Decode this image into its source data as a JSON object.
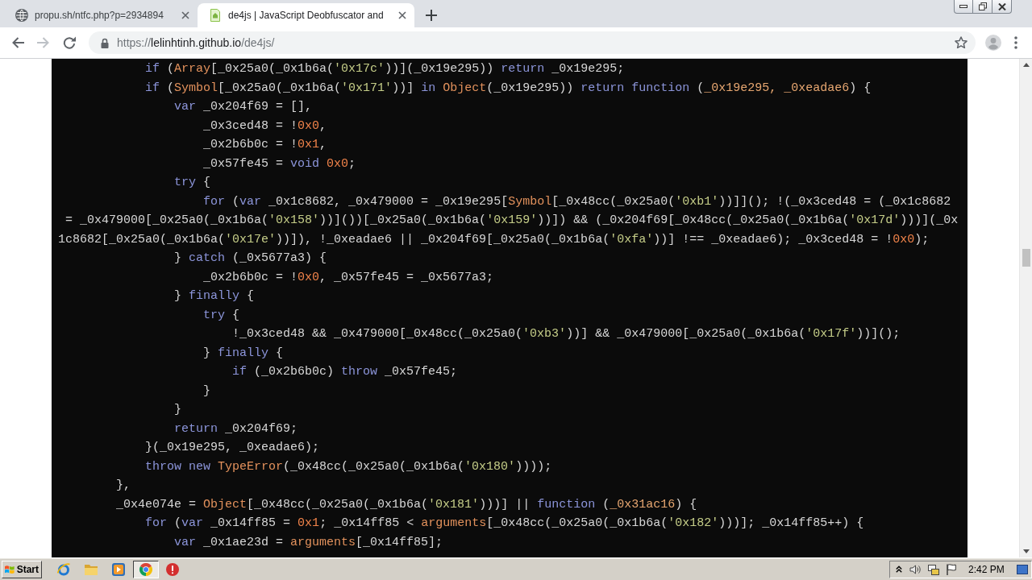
{
  "browser": {
    "tabs": [
      {
        "title": "propu.sh/ntfc.php?p=2934894",
        "selected": false
      },
      {
        "title": "de4js | JavaScript Deobfuscator and",
        "selected": true
      }
    ],
    "back": {
      "disabled": false
    },
    "forward": {
      "disabled": true
    },
    "address_bar": {
      "scheme": "https://",
      "host": "lelinhtinh.github.io",
      "path": "/de4js/"
    }
  },
  "code": {
    "lines": [
      [
        {
          "kind": "keyword",
          "text": "            if"
        },
        {
          "kind": "plain",
          "text": " ("
        },
        {
          "kind": "builtin",
          "text": "Array"
        },
        {
          "kind": "plain",
          "text": "[_0x25a0(_0x1b6a("
        },
        {
          "kind": "string",
          "text": "'0x17c'"
        },
        {
          "kind": "plain",
          "text": "))](_0x19e295)) "
        },
        {
          "kind": "keyword",
          "text": "return"
        },
        {
          "kind": "plain",
          "text": " _0x19e295;"
        }
      ],
      [
        {
          "kind": "keyword",
          "text": "            if"
        },
        {
          "kind": "plain",
          "text": " ("
        },
        {
          "kind": "builtin",
          "text": "Symbol"
        },
        {
          "kind": "plain",
          "text": "[_0x25a0(_0x1b6a("
        },
        {
          "kind": "string",
          "text": "'0x171'"
        },
        {
          "kind": "plain",
          "text": "))] "
        },
        {
          "kind": "keyword",
          "text": "in "
        },
        {
          "kind": "builtin",
          "text": "Object"
        },
        {
          "kind": "plain",
          "text": "(_0x19e295)) "
        },
        {
          "kind": "keyword",
          "text": "return function"
        },
        {
          "kind": "plain",
          "text": " ("
        },
        {
          "kind": "param",
          "text": "_0x19e295, _0xeadae6"
        },
        {
          "kind": "plain",
          "text": ") {"
        }
      ],
      [
        {
          "kind": "keyword",
          "text": "                var"
        },
        {
          "kind": "plain",
          "text": " _0x204f69 = [],"
        }
      ],
      [
        {
          "kind": "plain",
          "text": "                    _0x3ced48 = !"
        },
        {
          "kind": "number",
          "text": "0x0"
        },
        {
          "kind": "plain",
          "text": ","
        }
      ],
      [
        {
          "kind": "plain",
          "text": "                    _0x2b6b0c = !"
        },
        {
          "kind": "number",
          "text": "0x1"
        },
        {
          "kind": "plain",
          "text": ","
        }
      ],
      [
        {
          "kind": "plain",
          "text": "                    _0x57fe45 = "
        },
        {
          "kind": "keyword",
          "text": "void "
        },
        {
          "kind": "number",
          "text": "0x0"
        },
        {
          "kind": "plain",
          "text": ";"
        }
      ],
      [
        {
          "kind": "keyword",
          "text": "                try"
        },
        {
          "kind": "plain",
          "text": " {"
        }
      ],
      [
        {
          "kind": "keyword",
          "text": "                    for"
        },
        {
          "kind": "plain",
          "text": " ("
        },
        {
          "kind": "keyword",
          "text": "var"
        },
        {
          "kind": "plain",
          "text": " _0x1c8682, _0x479000 = _0x19e295["
        },
        {
          "kind": "builtin",
          "text": "Symbol"
        },
        {
          "kind": "plain",
          "text": "[_0x48cc(_0x25a0("
        },
        {
          "kind": "string",
          "text": "'0xb1'"
        },
        {
          "kind": "plain",
          "text": "))]](); !(_0x3ced48 = (_0x1c8682"
        }
      ],
      [
        {
          "kind": "plain",
          "text": " = _0x479000[_0x25a0(_0x1b6a("
        },
        {
          "kind": "string",
          "text": "'0x158'"
        },
        {
          "kind": "plain",
          "text": "))]())[_0x25a0(_0x1b6a("
        },
        {
          "kind": "string",
          "text": "'0x159'"
        },
        {
          "kind": "plain",
          "text": "))]) && (_0x204f69[_0x48cc(_0x25a0(_0x1b6a("
        },
        {
          "kind": "string",
          "text": "'0x17d'"
        },
        {
          "kind": "plain",
          "text": ")))](_0x"
        }
      ],
      [
        {
          "kind": "plain",
          "text": "1c8682[_0x25a0(_0x1b6a("
        },
        {
          "kind": "string",
          "text": "'0x17e'"
        },
        {
          "kind": "plain",
          "text": "))]), !_0xeadae6 || _0x204f69[_0x25a0(_0x1b6a("
        },
        {
          "kind": "string",
          "text": "'0xfa'"
        },
        {
          "kind": "plain",
          "text": "))] !== _0xeadae6); _0x3ced48 = !"
        },
        {
          "kind": "number",
          "text": "0x0"
        },
        {
          "kind": "plain",
          "text": ");"
        }
      ],
      [
        {
          "kind": "plain",
          "text": "                } "
        },
        {
          "kind": "keyword",
          "text": "catch"
        },
        {
          "kind": "plain",
          "text": " (_0x5677a3) {"
        }
      ],
      [
        {
          "kind": "plain",
          "text": "                    _0x2b6b0c = !"
        },
        {
          "kind": "number",
          "text": "0x0"
        },
        {
          "kind": "plain",
          "text": ", _0x57fe45 = _0x5677a3;"
        }
      ],
      [
        {
          "kind": "plain",
          "text": "                } "
        },
        {
          "kind": "keyword",
          "text": "finally"
        },
        {
          "kind": "plain",
          "text": " {"
        }
      ],
      [
        {
          "kind": "keyword",
          "text": "                    try"
        },
        {
          "kind": "plain",
          "text": " {"
        }
      ],
      [
        {
          "kind": "plain",
          "text": "                        !_0x3ced48 && _0x479000[_0x48cc(_0x25a0("
        },
        {
          "kind": "string",
          "text": "'0xb3'"
        },
        {
          "kind": "plain",
          "text": "))] && _0x479000[_0x25a0(_0x1b6a("
        },
        {
          "kind": "string",
          "text": "'0x17f'"
        },
        {
          "kind": "plain",
          "text": "))]();"
        }
      ],
      [
        {
          "kind": "plain",
          "text": "                    } "
        },
        {
          "kind": "keyword",
          "text": "finally"
        },
        {
          "kind": "plain",
          "text": " {"
        }
      ],
      [
        {
          "kind": "keyword",
          "text": "                        if"
        },
        {
          "kind": "plain",
          "text": " (_0x2b6b0c) "
        },
        {
          "kind": "keyword",
          "text": "throw"
        },
        {
          "kind": "plain",
          "text": " _0x57fe45;"
        }
      ],
      [
        {
          "kind": "plain",
          "text": "                    }"
        }
      ],
      [
        {
          "kind": "plain",
          "text": "                }"
        }
      ],
      [
        {
          "kind": "keyword",
          "text": "                return"
        },
        {
          "kind": "plain",
          "text": " _0x204f69;"
        }
      ],
      [
        {
          "kind": "plain",
          "text": "            }(_0x19e295, _0xeadae6);"
        }
      ],
      [
        {
          "kind": "keyword",
          "text": "            throw new "
        },
        {
          "kind": "builtin",
          "text": "TypeError"
        },
        {
          "kind": "plain",
          "text": "(_0x48cc(_0x25a0(_0x1b6a("
        },
        {
          "kind": "string",
          "text": "'0x180'"
        },
        {
          "kind": "plain",
          "text": "))));"
        }
      ],
      [
        {
          "kind": "plain",
          "text": "        },"
        }
      ],
      [
        {
          "kind": "plain",
          "text": "        _0x4e074e = "
        },
        {
          "kind": "builtin",
          "text": "Object"
        },
        {
          "kind": "plain",
          "text": "[_0x48cc(_0x25a0(_0x1b6a("
        },
        {
          "kind": "string",
          "text": "'0x181'"
        },
        {
          "kind": "plain",
          "text": ")))] || "
        },
        {
          "kind": "keyword",
          "text": "function"
        },
        {
          "kind": "plain",
          "text": " ("
        },
        {
          "kind": "param",
          "text": "_0x31ac16"
        },
        {
          "kind": "plain",
          "text": ") {"
        }
      ],
      [
        {
          "kind": "keyword",
          "text": "            for"
        },
        {
          "kind": "plain",
          "text": " ("
        },
        {
          "kind": "keyword",
          "text": "var"
        },
        {
          "kind": "plain",
          "text": " _0x14ff85 = "
        },
        {
          "kind": "number",
          "text": "0x1"
        },
        {
          "kind": "plain",
          "text": "; _0x14ff85 < "
        },
        {
          "kind": "builtin",
          "text": "arguments"
        },
        {
          "kind": "plain",
          "text": "[_0x48cc(_0x25a0(_0x1b6a("
        },
        {
          "kind": "string",
          "text": "'0x182'"
        },
        {
          "kind": "plain",
          "text": ")))]; _0x14ff85++) {"
        }
      ],
      [
        {
          "kind": "keyword",
          "text": "                var"
        },
        {
          "kind": "plain",
          "text": " _0x1ae23d = "
        },
        {
          "kind": "builtin",
          "text": "arguments"
        },
        {
          "kind": "plain",
          "text": "[_0x14ff85];"
        }
      ]
    ]
  },
  "taskbar": {
    "start_button": "Start",
    "clock": "2:42 PM"
  }
}
